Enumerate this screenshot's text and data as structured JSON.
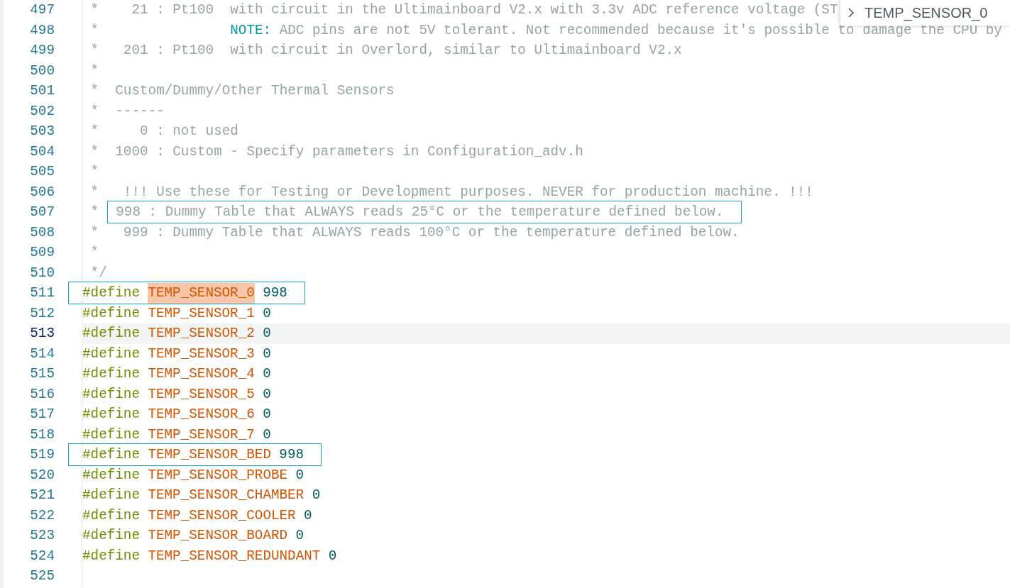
{
  "find_widget": {
    "value": "TEMP_SENSOR_0"
  },
  "lines": [
    {
      "number": "497",
      "current": false,
      "tokens": [
        {
          "kind": "comment",
          "text": " *    21 : Pt100  with circuit in the Ultimainboard V2.x with 3.3v ADC reference voltage (ST"
        }
      ]
    },
    {
      "number": "498",
      "current": false,
      "tokens": [
        {
          "kind": "comment",
          "text": " *                "
        },
        {
          "kind": "note",
          "text": "NOTE:"
        },
        {
          "kind": "comment",
          "text": " ADC pins are not 5V tolerant. Not recommended because it's possible to damage the CPU by"
        }
      ]
    },
    {
      "number": "499",
      "current": false,
      "tokens": [
        {
          "kind": "comment",
          "text": " *   201 : Pt100  with circuit in Overlord, similar to Ultimainboard V2.x"
        }
      ]
    },
    {
      "number": "500",
      "current": false,
      "tokens": [
        {
          "kind": "comment",
          "text": " *"
        }
      ]
    },
    {
      "number": "501",
      "current": false,
      "tokens": [
        {
          "kind": "comment",
          "text": " *  Custom/Dummy/Other Thermal Sensors"
        }
      ]
    },
    {
      "number": "502",
      "current": false,
      "tokens": [
        {
          "kind": "comment",
          "text": " *  ------"
        }
      ]
    },
    {
      "number": "503",
      "current": false,
      "tokens": [
        {
          "kind": "comment",
          "text": " *     0 : not used"
        }
      ]
    },
    {
      "number": "504",
      "current": false,
      "tokens": [
        {
          "kind": "comment",
          "text": " *  1000 : Custom - Specify parameters in Configuration_adv.h"
        }
      ]
    },
    {
      "number": "505",
      "current": false,
      "tokens": [
        {
          "kind": "comment",
          "text": " *"
        }
      ]
    },
    {
      "number": "506",
      "current": false,
      "tokens": [
        {
          "kind": "comment",
          "text": " *   !!! Use these for Testing or Development purposes. NEVER for production machine. !!!"
        }
      ]
    },
    {
      "number": "507",
      "current": false,
      "tokens": [
        {
          "kind": "comment",
          "text": " * "
        }
      ],
      "frame": [
        {
          "kind": "comment",
          "text": " 998 : Dummy Table that ALWAYS reads 25°C or the temperature defined below."
        }
      ]
    },
    {
      "number": "508",
      "current": false,
      "tokens": [
        {
          "kind": "comment",
          "text": " *   999 : Dummy Table that ALWAYS reads 100°C or the temperature defined below."
        }
      ]
    },
    {
      "number": "509",
      "current": false,
      "tokens": [
        {
          "kind": "comment",
          "text": " *"
        }
      ]
    },
    {
      "number": "510",
      "current": false,
      "tokens": [
        {
          "kind": "comment",
          "text": " */"
        }
      ]
    },
    {
      "number": "511",
      "current": false,
      "frame": [
        {
          "kind": "directive",
          "text": "#define"
        },
        {
          "kind": "macro",
          "text": "TEMP_SENSOR_0",
          "match": true
        },
        {
          "kind": "number",
          "text": "998"
        }
      ]
    },
    {
      "number": "512",
      "current": false,
      "tokens": [
        {
          "kind": "directive",
          "text": "#define"
        },
        {
          "kind": "macro",
          "text": "TEMP_SENSOR_1"
        },
        {
          "kind": "number",
          "text": "0"
        }
      ]
    },
    {
      "number": "513",
      "current": true,
      "tokens": [
        {
          "kind": "directive",
          "text": "#define"
        },
        {
          "kind": "macro",
          "text": "TEMP_SENSOR_2"
        },
        {
          "kind": "number",
          "text": "0"
        }
      ]
    },
    {
      "number": "514",
      "current": false,
      "tokens": [
        {
          "kind": "directive",
          "text": "#define"
        },
        {
          "kind": "macro",
          "text": "TEMP_SENSOR_3"
        },
        {
          "kind": "number",
          "text": "0"
        }
      ]
    },
    {
      "number": "515",
      "current": false,
      "tokens": [
        {
          "kind": "directive",
          "text": "#define"
        },
        {
          "kind": "macro",
          "text": "TEMP_SENSOR_4"
        },
        {
          "kind": "number",
          "text": "0"
        }
      ]
    },
    {
      "number": "516",
      "current": false,
      "tokens": [
        {
          "kind": "directive",
          "text": "#define"
        },
        {
          "kind": "macro",
          "text": "TEMP_SENSOR_5"
        },
        {
          "kind": "number",
          "text": "0"
        }
      ]
    },
    {
      "number": "517",
      "current": false,
      "tokens": [
        {
          "kind": "directive",
          "text": "#define"
        },
        {
          "kind": "macro",
          "text": "TEMP_SENSOR_6"
        },
        {
          "kind": "number",
          "text": "0"
        }
      ]
    },
    {
      "number": "518",
      "current": false,
      "tokens": [
        {
          "kind": "directive",
          "text": "#define"
        },
        {
          "kind": "macro",
          "text": "TEMP_SENSOR_7"
        },
        {
          "kind": "number",
          "text": "0"
        }
      ]
    },
    {
      "number": "519",
      "current": false,
      "frame": [
        {
          "kind": "directive",
          "text": "#define"
        },
        {
          "kind": "macro",
          "text": "TEMP_SENSOR_BED"
        },
        {
          "kind": "number",
          "text": "998"
        }
      ]
    },
    {
      "number": "520",
      "current": false,
      "tokens": [
        {
          "kind": "directive",
          "text": "#define"
        },
        {
          "kind": "macro",
          "text": "TEMP_SENSOR_PROBE"
        },
        {
          "kind": "number",
          "text": "0"
        }
      ]
    },
    {
      "number": "521",
      "current": false,
      "tokens": [
        {
          "kind": "directive",
          "text": "#define"
        },
        {
          "kind": "macro",
          "text": "TEMP_SENSOR_CHAMBER"
        },
        {
          "kind": "number",
          "text": "0"
        }
      ]
    },
    {
      "number": "522",
      "current": false,
      "tokens": [
        {
          "kind": "directive",
          "text": "#define"
        },
        {
          "kind": "macro",
          "text": "TEMP_SENSOR_COOLER"
        },
        {
          "kind": "number",
          "text": "0"
        }
      ]
    },
    {
      "number": "523",
      "current": false,
      "tokens": [
        {
          "kind": "directive",
          "text": "#define"
        },
        {
          "kind": "macro",
          "text": "TEMP_SENSOR_BOARD"
        },
        {
          "kind": "number",
          "text": "0"
        }
      ]
    },
    {
      "number": "524",
      "current": false,
      "tokens": [
        {
          "kind": "directive",
          "text": "#define"
        },
        {
          "kind": "macro",
          "text": "TEMP_SENSOR_REDUNDANT"
        },
        {
          "kind": "number",
          "text": "0"
        }
      ]
    },
    {
      "number": "525",
      "current": false
    }
  ]
}
